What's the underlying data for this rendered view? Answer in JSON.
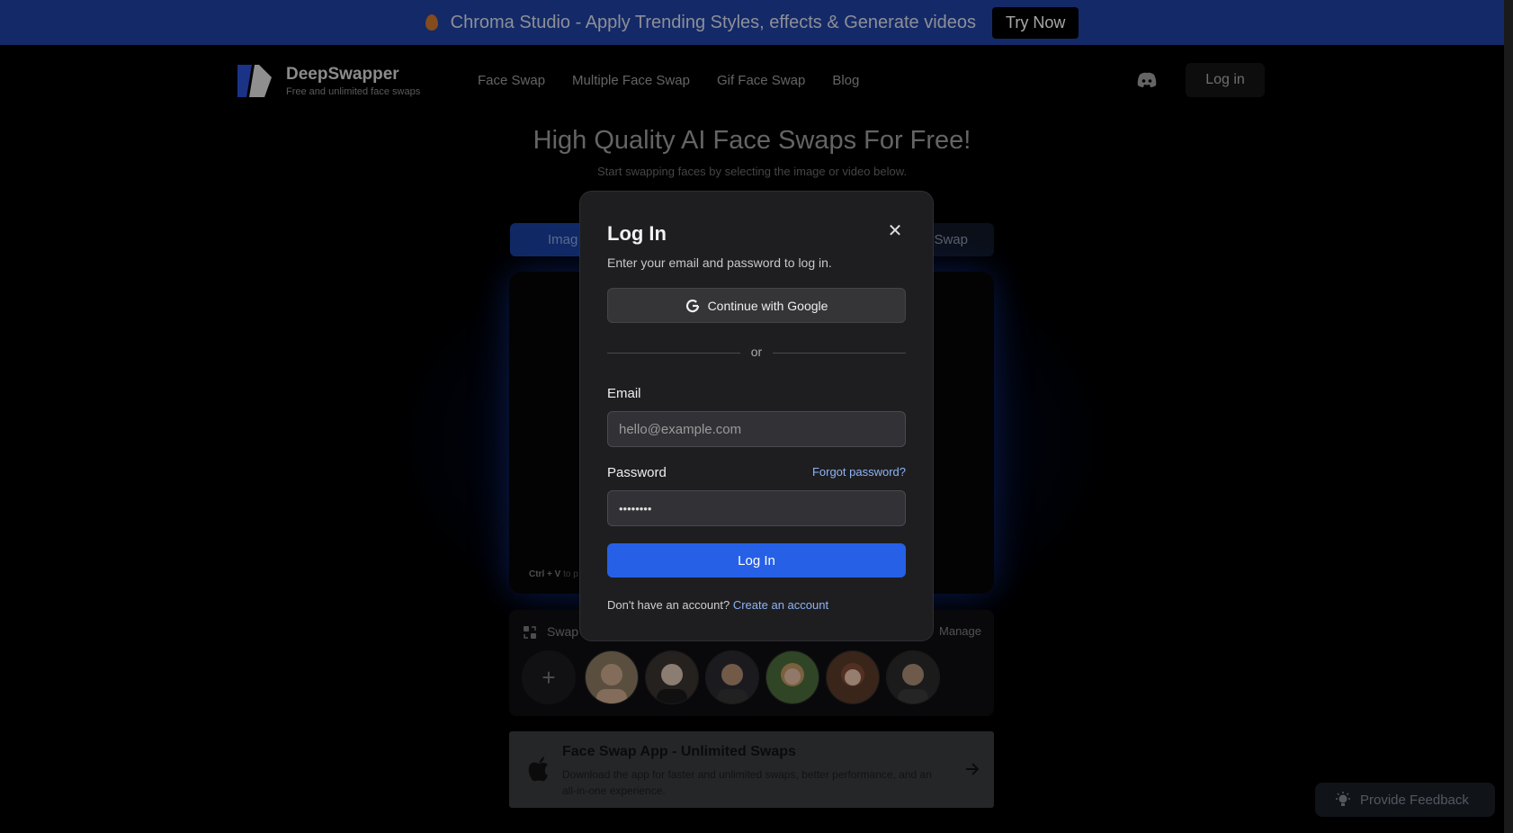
{
  "banner": {
    "text": "Chroma Studio - Apply Trending Styles, effects & Generate videos",
    "cta": "Try Now",
    "icon": "flame-icon"
  },
  "nav": {
    "brand_name": "DeepSwapper",
    "brand_tagline": "Free and unlimited face swaps",
    "links": [
      "Face Swap",
      "Multiple Face Swap",
      "Gif Face Swap",
      "Blog"
    ],
    "login": "Log in"
  },
  "hero": {
    "title": "High Quality AI Face Swaps For Free!",
    "subtitle": "Start swapping faces by selecting the image or video below."
  },
  "tabs": {
    "image": "Imag",
    "swap": "Swap"
  },
  "drop_area": {
    "hint_key": "Ctrl + V",
    "hint_text": " to p"
  },
  "faces": {
    "label": "Swap",
    "manage": "Manage",
    "add": "+",
    "colors": [
      "#8a7a62",
      "#3a3430",
      "#2a2a30",
      "#b89560",
      "#7d4a36",
      "#3a3a3a"
    ]
  },
  "app_card": {
    "title": "Face Swap App - Unlimited Swaps",
    "description": "Download the app for faster and unlimited swaps, better performance, and an all-in-one experience."
  },
  "feedback": {
    "label": "Provide Feedback"
  },
  "modal": {
    "title": "Log In",
    "subtitle": "Enter your email and password to log in.",
    "google_button": "Continue with Google",
    "or": "or",
    "email_label": "Email",
    "email_placeholder": "hello@example.com",
    "password_label": "Password",
    "forgot_password": "Forgot password?",
    "password_value": "••••••••",
    "submit": "Log In",
    "no_account": "Don't have an account?",
    "create_account": "Create an account"
  },
  "colors": {
    "accent": "#2660e6",
    "banner": "#1f3f9e",
    "link": "#8db4f5"
  }
}
